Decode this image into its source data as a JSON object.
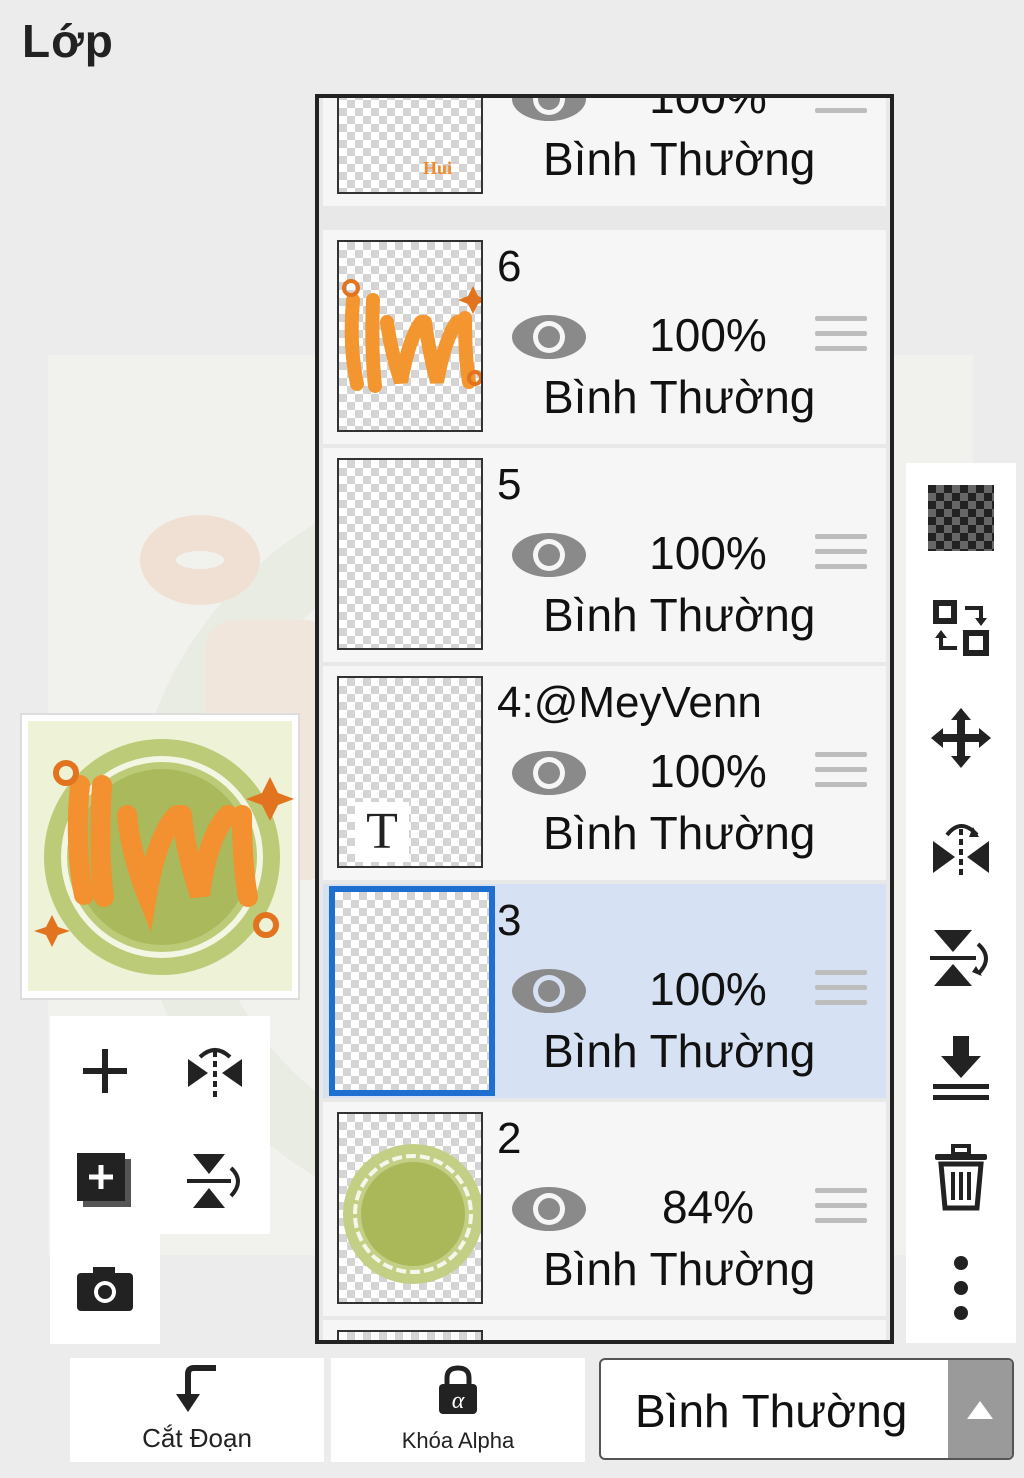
{
  "panel": {
    "title": "Lớp"
  },
  "layers": [
    {
      "name": "",
      "opacity": "100%",
      "blend": "Bình Thường"
    },
    {
      "name": "6",
      "opacity": "100%",
      "blend": "Bình Thường"
    },
    {
      "name": "5",
      "opacity": "100%",
      "blend": "Bình Thường"
    },
    {
      "name": "4:@MeyVenn",
      "opacity": "100%",
      "blend": "Bình Thường",
      "text_layer_glyph": "T"
    },
    {
      "name": "3",
      "opacity": "100%",
      "blend": "Bình Thường",
      "selected": true
    },
    {
      "name": "2",
      "opacity": "84%",
      "blend": "Bình Thường"
    }
  ],
  "bottom": {
    "clip_label": "Cắt Đoạn",
    "alpha_lock_label": "Khóa Alpha",
    "blend_mode": "Bình Thường"
  },
  "left_tools": [
    "add-layer",
    "flip-horizontal",
    "add-layer-copy",
    "flip-vertical",
    "camera"
  ],
  "right_tools": [
    "transparency",
    "swap-layer",
    "move",
    "flip-horizontal",
    "flip-vertical",
    "merge-down",
    "delete",
    "more"
  ],
  "colors": {
    "selection": "#1f6fd1",
    "selected_row": "#d6e2f4",
    "accent_orange": "#f08a2c",
    "accent_green": "#b0bf5a"
  }
}
